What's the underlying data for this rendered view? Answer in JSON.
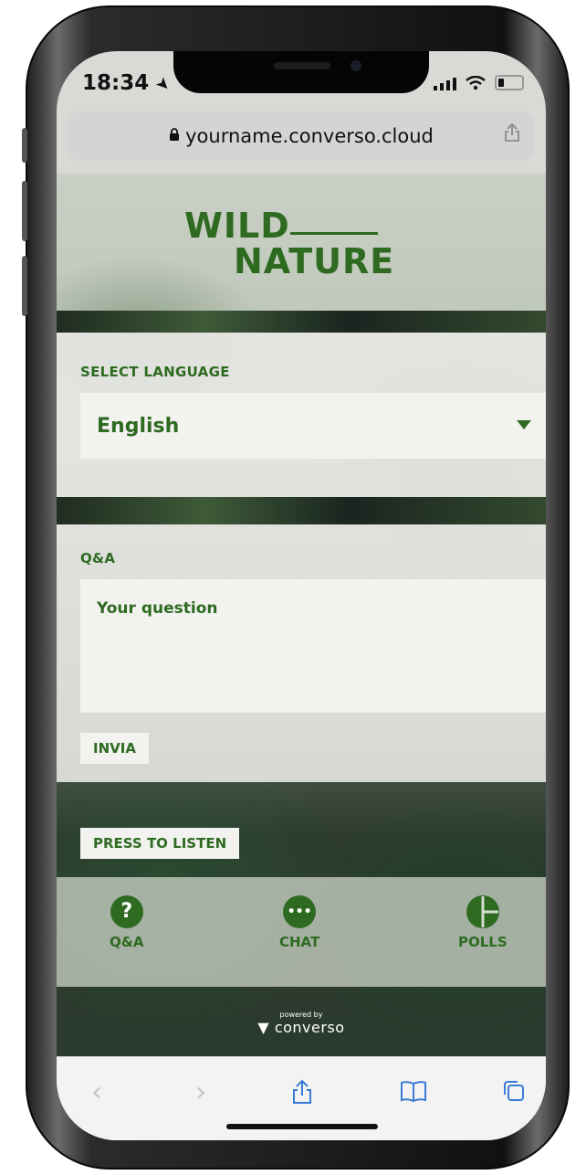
{
  "status_bar": {
    "time": "18:34",
    "location_glyph": "◁"
  },
  "browser": {
    "url": "yourname.converso.cloud",
    "lock_glyph": "🔒",
    "share_glyph": "⎙"
  },
  "logo": {
    "line1": "WILD",
    "line2": "NATURE"
  },
  "language": {
    "label": "SELECT LANGUAGE",
    "selected": "English"
  },
  "qa": {
    "label": "Q&A",
    "placeholder": "Your question",
    "submit_label": "INVIA"
  },
  "listen": {
    "label": "PRESS TO LISTEN"
  },
  "tabs": [
    {
      "label": "Q&A",
      "icon": "question-bubble-icon",
      "glyph": "?"
    },
    {
      "label": "CHAT",
      "icon": "chat-bubble-icon",
      "glyph": "•••"
    },
    {
      "label": "POLLS",
      "icon": "pie-chart-icon",
      "glyph": ""
    }
  ],
  "footer": {
    "powered_by": "powered by",
    "brand": "converso"
  },
  "safari_toolbar": {
    "back": "‹",
    "forward": "›",
    "share": "⇪",
    "bookmarks": "📖",
    "tabs": "⧉"
  },
  "colors": {
    "brand_green": "#2e6b21",
    "safari_blue": "#3a7bd5"
  }
}
